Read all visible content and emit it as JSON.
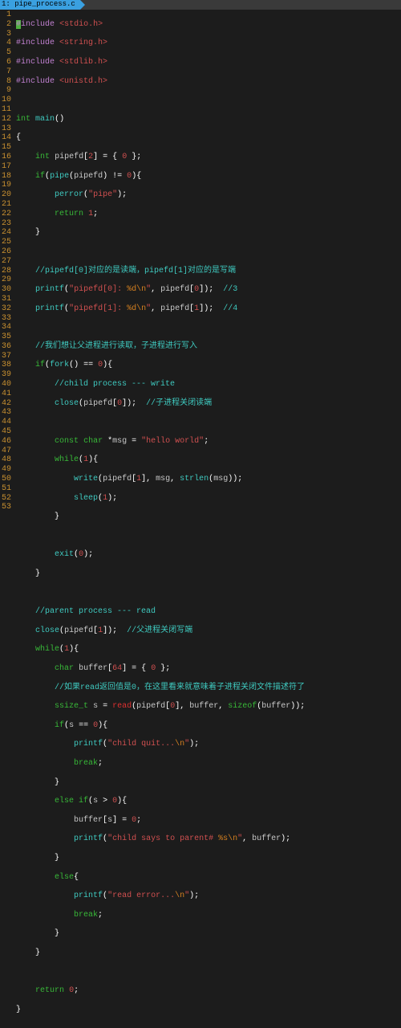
{
  "tab": {
    "index": "1:",
    "filename": "pipe_process.c"
  },
  "symbols": {
    "hash_include": "#include",
    "hdr_stdio": "<stdio.h>",
    "hdr_string": "<string.h>",
    "hdr_stdlib": "<stdlib.h>",
    "hdr_unistd": "<unistd.h>",
    "int": "int",
    "main": "main",
    "pipefd_decl": "pipefd",
    "zero": "0",
    "one": "1",
    "two": "2",
    "three": "3",
    "four": "4",
    "sixty_four": "64",
    "if": "if",
    "else": "else",
    "else_if": "else if",
    "while": "while",
    "return": "return",
    "const": "const",
    "char": "char",
    "ssize_t": "ssize_t",
    "pipe": "pipe",
    "perror": "perror",
    "printf": "printf",
    "fork": "fork",
    "close": "close",
    "write": "write",
    "strlen": "strlen",
    "sleep": "sleep",
    "exit": "exit",
    "read": "read",
    "break": "break",
    "sizeof": "sizeof",
    "pipe_str": "\"pipe\"",
    "fmt0": "\"pipefd[0]: ",
    "fmt_d": "%d",
    "nl": "\\n",
    "endq": "\"",
    "fmt1": "\"pipefd[1]: ",
    "hello_world": "\"hello world\"",
    "child_quit": "\"child quit...",
    "says_to_parent": "\"child says to parent# ",
    "pct_s": "%s",
    "read_error": "\"read error...",
    "cm1": "//pipefd[0]对应的是读端，pipefd[1]对应的是写端",
    "cm_3": "//3",
    "cm_4": "//4",
    "cm2": "//我们想让父进程进行读取，子进程进行写入",
    "cm_child": "//child process --- write",
    "cm_close_read": "//子进程关闭读端",
    "cm_parent": "//parent process --- read",
    "cm_close_write": "//父进程关闭写端",
    "cm_read_zero": "//如果read返回值是0，在这里看来就意味着子进程关闭文件描述符了",
    "msg": "msg",
    "buffer": "buffer",
    "s": "s",
    "pipefd": "pipefd"
  },
  "linenos": [
    "1",
    "2",
    "3",
    "4",
    "5",
    "6",
    "7",
    "8",
    "9",
    "10",
    "11",
    "12",
    "13",
    "14",
    "15",
    "16",
    "17",
    "18",
    "19",
    "20",
    "21",
    "22",
    "23",
    "24",
    "25",
    "26",
    "27",
    "28",
    "29",
    "30",
    "31",
    "32",
    "33",
    "34",
    "35",
    "36",
    "37",
    "38",
    "39",
    "40",
    "41",
    "42",
    "43",
    "44",
    "45",
    "46",
    "47",
    "48",
    "49",
    "50",
    "51",
    "52",
    "53"
  ]
}
